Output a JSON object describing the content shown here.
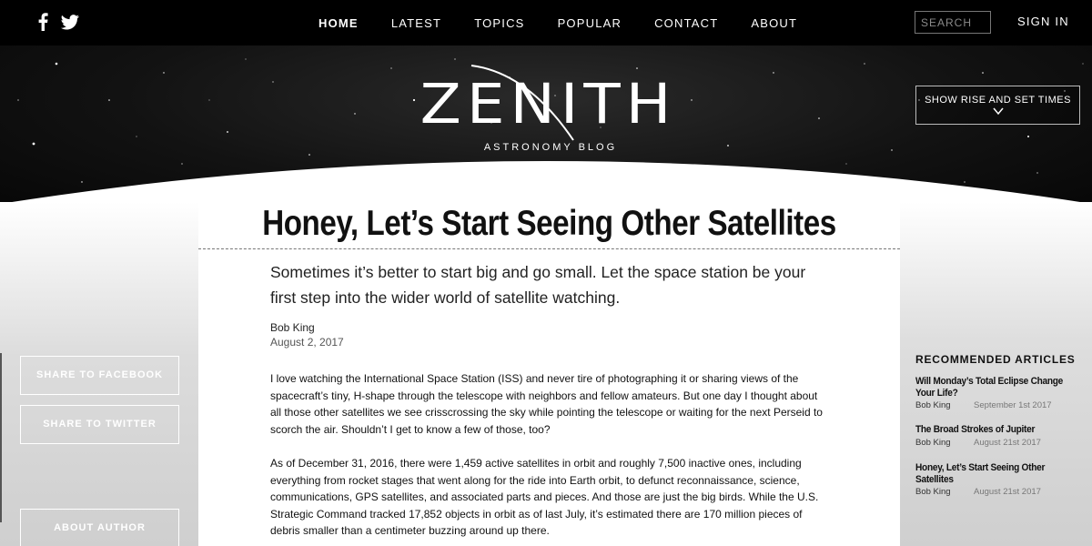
{
  "social": {
    "facebook_icon": "facebook-icon",
    "twitter_icon": "twitter-icon"
  },
  "nav": {
    "items": [
      {
        "label": "HOME"
      },
      {
        "label": "LATEST"
      },
      {
        "label": "TOPICS"
      },
      {
        "label": "POPULAR"
      },
      {
        "label": "CONTACT"
      },
      {
        "label": "ABOUT"
      }
    ],
    "search_placeholder": "SEARCH",
    "signin": "SIGN IN"
  },
  "hero": {
    "logo": "ZENITH",
    "logo_sub": "ASTRONOMY BLOG",
    "rise_button": "SHOW RISE AND SET TIMES"
  },
  "sidebar": {
    "share_facebook": "SHARE TO FACEBOOK",
    "share_twitter": "SHARE TO TWITTER",
    "about_author": "ABOUT AUTHOR"
  },
  "article": {
    "title": "Honey, Let’s Start Seeing Other Satellites",
    "deck": "Sometimes it’s better to start big and go small. Let the space station be your first step into the wider world of satellite watching.",
    "author": "Bob King",
    "date": "August 2, 2017",
    "paragraphs": [
      "I love watching the International Space Station (ISS) and never tire of photographing it or sharing views of the spacecraft’s tiny, H-shape through the telescope with neighbors and fellow amateurs. But one day I thought about all those other satellites we see crisscrossing the sky while pointing the telescope or waiting for the next Perseid to scorch the air. Shouldn’t I get to know a few of those, too?",
      "As of December 31, 2016, there were 1,459 active satellites in orbit and roughly 7,500 inactive ones, including everything from rocket stages that went along for the ride into Earth orbit, to defunct reconnaissance, science, communications, GPS satellites, and associated parts and pieces. And those are just the big birds. While the U.S. Strategic Command tracked 17,852 objects in orbit as of last July, it’s estimated there are 170 million pieces of debris smaller than a centimeter buzzing around up there."
    ]
  },
  "recommended": {
    "heading": "RECOMMENDED ARTICLES",
    "items": [
      {
        "title": "Will Monday’s Total Eclipse Change Your Life?",
        "author": "Bob King",
        "date": "September 1st 2017"
      },
      {
        "title": "The Broad Strokes of Jupiter",
        "author": "Bob King",
        "date": "August 21st 2017"
      },
      {
        "title": "Honey, Let’s Start Seeing Other Satellites",
        "author": "Bob King",
        "date": "August 21st 2017"
      }
    ]
  }
}
